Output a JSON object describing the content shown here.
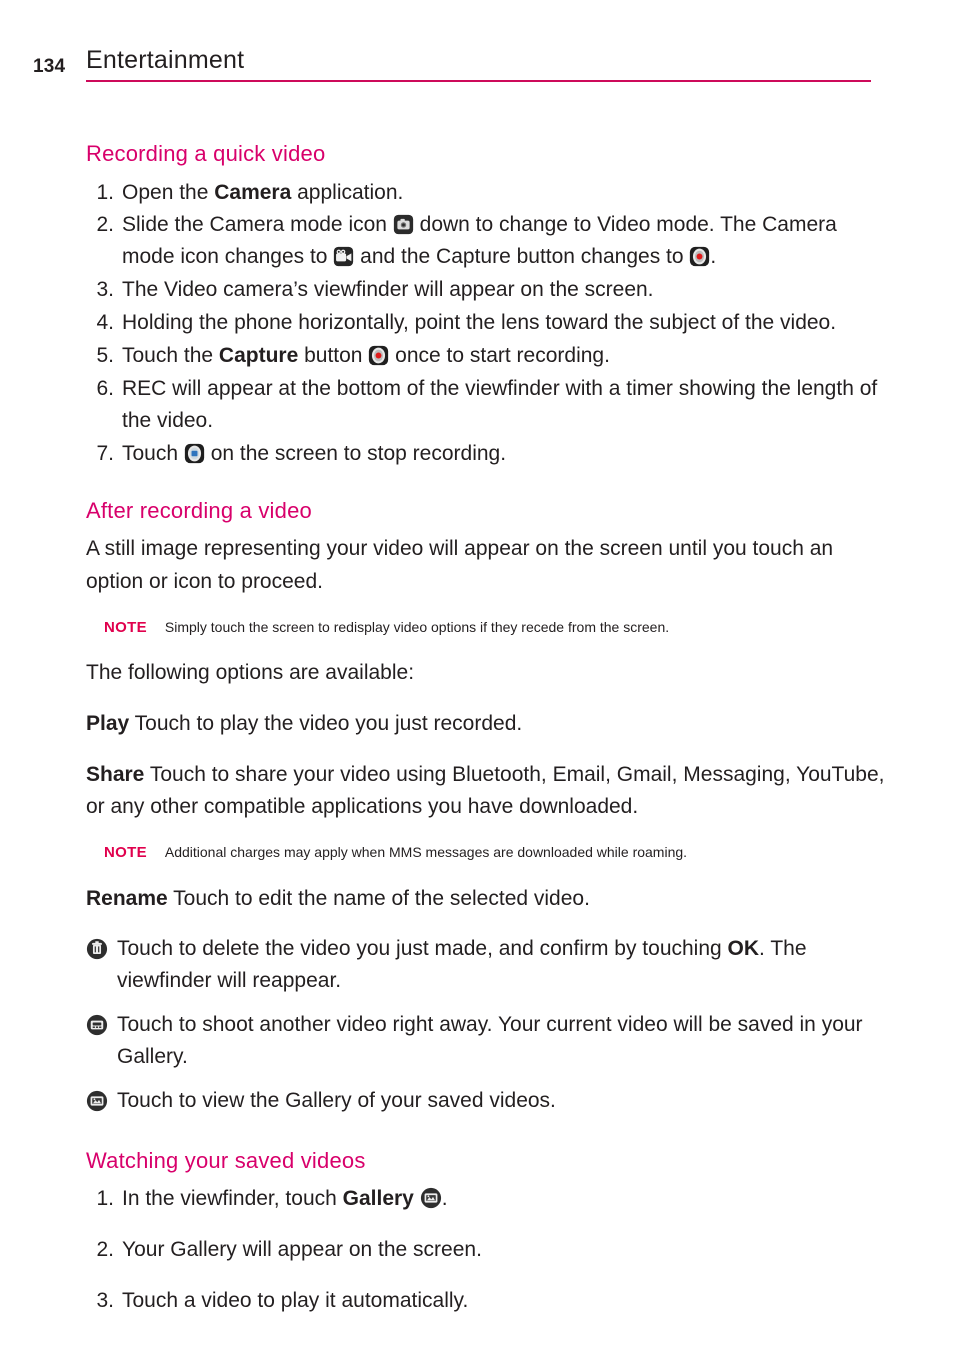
{
  "header": {
    "page_number": "134",
    "title": "Entertainment",
    "rule_color": "#cd0a5a"
  },
  "colors": {
    "heading_magenta": "#d8006b",
    "note_magenta": "#e0004d",
    "body_text": "#231f20"
  },
  "sections": {
    "recording": {
      "heading": "Recording a quick video",
      "steps": [
        {
          "marker": "1.",
          "parts": [
            {
              "t": "text",
              "v": "Open the "
            },
            {
              "t": "bold",
              "v": "Camera"
            },
            {
              "t": "text",
              "v": " application."
            }
          ]
        },
        {
          "marker": "2.",
          "parts": [
            {
              "t": "text",
              "v": "Slide the Camera mode icon "
            },
            {
              "t": "icon",
              "v": "camera-mode-icon"
            },
            {
              "t": "text",
              "v": " down to change to Video mode. The Camera mode icon changes to "
            },
            {
              "t": "icon",
              "v": "video-mode-icon"
            },
            {
              "t": "text",
              "v": " and the Capture button changes to "
            },
            {
              "t": "icon",
              "v": "record-capture-icon"
            },
            {
              "t": "text",
              "v": "."
            }
          ]
        },
        {
          "marker": "3.",
          "parts": [
            {
              "t": "text",
              "v": "The Video camera’s viewfinder will appear on the screen."
            }
          ]
        },
        {
          "marker": "4.",
          "parts": [
            {
              "t": "text",
              "v": "Holding the phone horizontally, point the lens toward the subject of the video."
            }
          ]
        },
        {
          "marker": "5.",
          "parts": [
            {
              "t": "text",
              "v": "Touch the "
            },
            {
              "t": "bold",
              "v": "Capture"
            },
            {
              "t": "text",
              "v": " button "
            },
            {
              "t": "icon",
              "v": "record-capture-icon"
            },
            {
              "t": "text",
              "v": " once to start recording."
            }
          ]
        },
        {
          "marker": "6.",
          "parts": [
            {
              "t": "text",
              "v": "REC will appear at the bottom of the viewfinder with a timer showing the length of the video."
            }
          ]
        },
        {
          "marker": "7.",
          "parts": [
            {
              "t": "text",
              "v": "Touch "
            },
            {
              "t": "icon",
              "v": "stop-recording-icon"
            },
            {
              "t": "text",
              "v": " on the screen to stop recording."
            }
          ]
        }
      ]
    },
    "after_recording": {
      "heading": "After recording a video",
      "intro": "A still image representing your video will appear on the screen until you touch an option or icon to proceed.",
      "note1_label": "NOTE",
      "note1_text": "Simply touch the screen to redisplay video options if they recede from the screen.",
      "options_lead": "The following options are available:",
      "option_play": {
        "parts": [
          {
            "t": "bold",
            "v": "Play"
          },
          {
            "t": "text",
            "v": " Touch to play the video you just recorded."
          }
        ]
      },
      "option_share": {
        "parts": [
          {
            "t": "bold",
            "v": "Share"
          },
          {
            "t": "text",
            "v": "  Touch to share your video using Bluetooth, Email, Gmail, Messaging, YouTube, or any other compatible applications you have downloaded."
          }
        ]
      },
      "note2_label": "NOTE",
      "note2_text": "Additional charges may apply when MMS messages are downloaded while roaming.",
      "option_rename": {
        "parts": [
          {
            "t": "bold",
            "v": "Rename"
          },
          {
            "t": "text",
            "v": " Touch to edit the name of the selected video."
          }
        ]
      },
      "icon_options": [
        {
          "icon": "delete-trash-icon",
          "parts": [
            {
              "t": "text",
              "v": "Touch to delete the video you just made, and confirm by touching "
            },
            {
              "t": "bold",
              "v": "OK"
            },
            {
              "t": "text",
              "v": ". The viewfinder will reappear."
            }
          ]
        },
        {
          "icon": "shoot-another-video-icon",
          "parts": [
            {
              "t": "text",
              "v": "Touch to shoot another video right away. Your current video will be saved in your Gallery."
            }
          ]
        },
        {
          "icon": "gallery-icon",
          "parts": [
            {
              "t": "text",
              "v": "Touch to view the Gallery of your saved videos."
            }
          ]
        }
      ]
    },
    "watching": {
      "heading": "Watching your saved videos",
      "steps": [
        {
          "marker": "1.",
          "parts": [
            {
              "t": "text",
              "v": "In the viewfinder, touch "
            },
            {
              "t": "bold",
              "v": "Gallery"
            },
            {
              "t": "text",
              "v": " "
            },
            {
              "t": "icon",
              "v": "gallery-icon"
            },
            {
              "t": "text",
              "v": "."
            }
          ]
        },
        {
          "marker": "2.",
          "parts": [
            {
              "t": "text",
              "v": "Your Gallery will appear on the screen."
            }
          ]
        },
        {
          "marker": "3.",
          "parts": [
            {
              "t": "text",
              "v": "Touch a video to play it automatically."
            }
          ]
        }
      ]
    }
  }
}
